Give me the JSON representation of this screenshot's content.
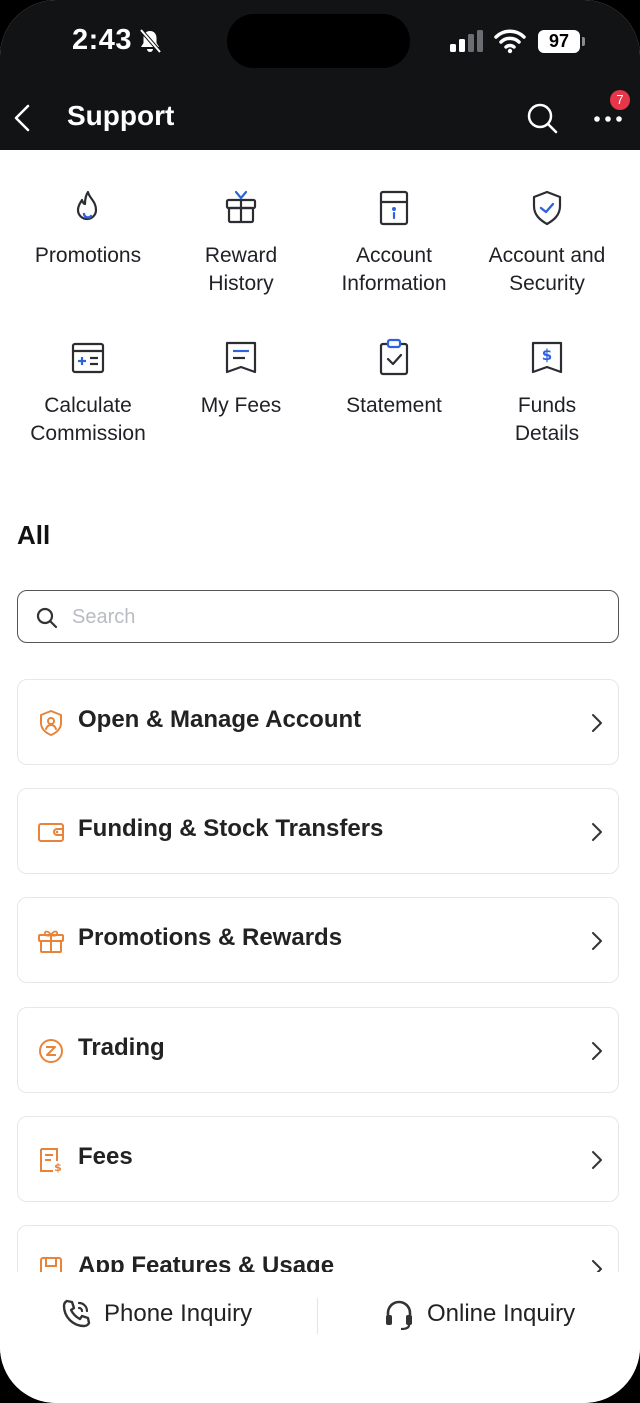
{
  "status_bar": {
    "time": "2:43",
    "battery": "97"
  },
  "header": {
    "title": "Support",
    "notification_badge": "7"
  },
  "quick_actions": [
    {
      "label_line1": "Promotions",
      "label_line2": "",
      "icon": "flame-icon"
    },
    {
      "label_line1": "Reward",
      "label_line2": "History",
      "icon": "gift-box-icon"
    },
    {
      "label_line1": "Account",
      "label_line2": "Information",
      "icon": "account-card-icon"
    },
    {
      "label_line1": "Account and",
      "label_line2": "Security",
      "icon": "shield-check-icon"
    },
    {
      "label_line1": "Calculate",
      "label_line2": "Commission",
      "icon": "calculator-icon"
    },
    {
      "label_line1": "My Fees",
      "label_line2": "",
      "icon": "fee-receipt-icon"
    },
    {
      "label_line1": "Statement",
      "label_line2": "",
      "icon": "clipboard-check-icon"
    },
    {
      "label_line1": "Funds",
      "label_line2": "Details",
      "icon": "dollar-receipt-icon"
    }
  ],
  "all_section": {
    "heading": "All",
    "search_placeholder": "Search",
    "search_value": ""
  },
  "categories": [
    {
      "label": "Open & Manage Account",
      "icon": "user-shield-icon"
    },
    {
      "label": "Funding & Stock Transfers",
      "icon": "wallet-icon"
    },
    {
      "label": "Promotions & Rewards",
      "icon": "gift-icon"
    },
    {
      "label": "Trading",
      "icon": "trading-icon"
    },
    {
      "label": "Fees",
      "icon": "fee-document-icon"
    },
    {
      "label": "App Features & Usage",
      "icon": "app-features-icon"
    }
  ],
  "bottom_bar": {
    "phone_label": "Phone Inquiry",
    "online_label": "Online Inquiry"
  },
  "colors": {
    "header_bg": "#121315",
    "accent_blue": "#2f62e0",
    "accent_orange": "#e8843a",
    "badge_red": "#e5364a"
  }
}
